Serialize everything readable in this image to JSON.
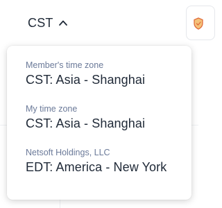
{
  "toggle": {
    "label": "CST",
    "expanded": true,
    "icon": "chevron-up-icon"
  },
  "corner_icon": {
    "icon": "shield-icon",
    "color": "#e06b3a"
  },
  "dropdown": {
    "sections": [
      {
        "caption": "Member's time zone",
        "value": "CST: Asia - Shanghai"
      },
      {
        "caption": "My time zone",
        "value": "CST: Asia - Shanghai"
      },
      {
        "caption": "Netsoft Holdings, LLC",
        "value": "EDT: America - New York"
      }
    ]
  },
  "colors": {
    "text_primary": "#1f2937",
    "text_secondary": "#6b7a99",
    "panel_bg": "#ffffff"
  }
}
